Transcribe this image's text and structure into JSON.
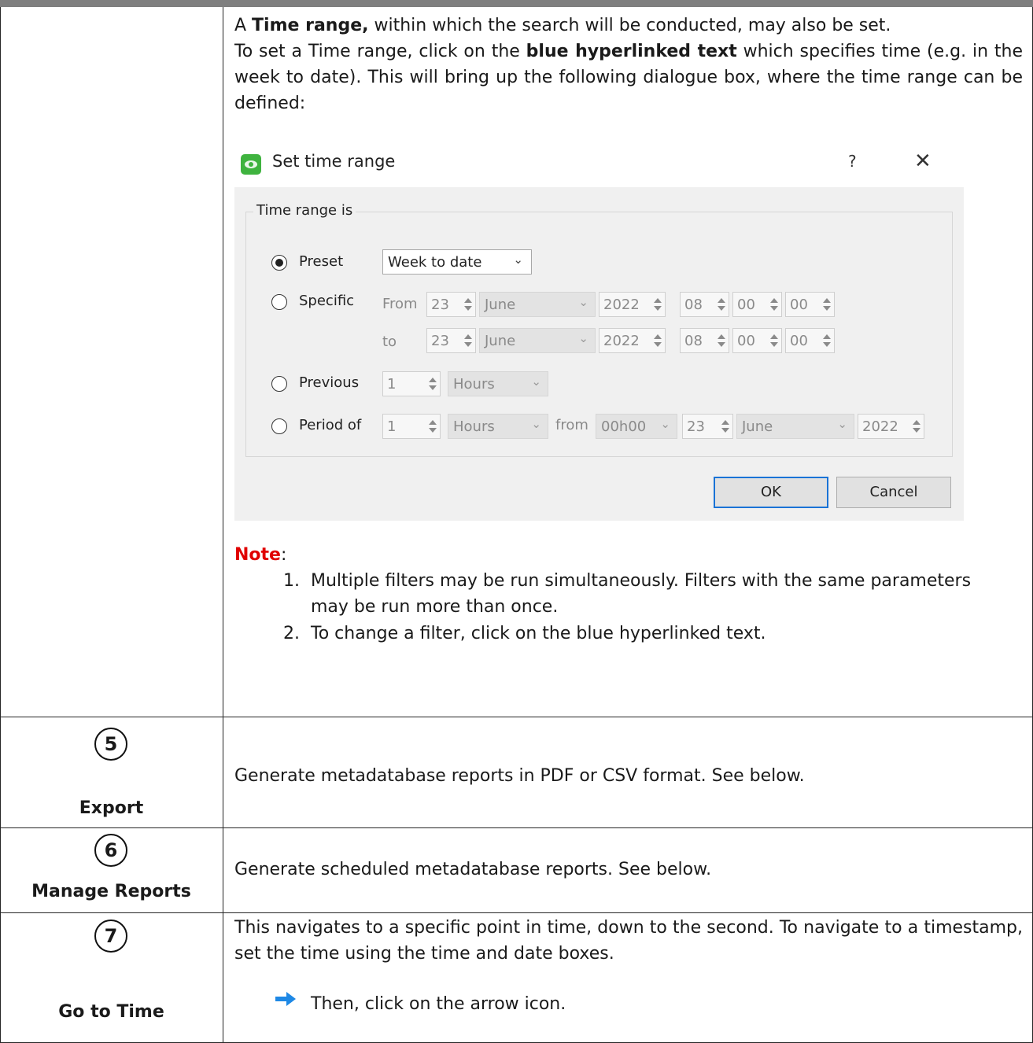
{
  "intro": {
    "line1_pre": "A ",
    "line1_bold": "Time range,",
    "line1_post": " within which the search will be conducted, may also be set.",
    "line2_pre": "To set a Time range, click on the ",
    "line2_bold": "blue hyperlinked text",
    "line2_post": " which specifies time (e.g. in the week to date). This will bring up the following dialogue box, where the time range can be defined:"
  },
  "dialog": {
    "title": "Set time range",
    "help": "?",
    "close": "✕",
    "group_label": "Time range is",
    "preset": {
      "label": "Preset",
      "value": "Week to date",
      "checked": true
    },
    "specific": {
      "label": "Specific",
      "from_label": "From",
      "to_label": "to",
      "from": {
        "day": "23",
        "month": "June",
        "year": "2022",
        "hour": "08",
        "minute": "00",
        "second": "00"
      },
      "to": {
        "day": "23",
        "month": "June",
        "year": "2022",
        "hour": "08",
        "minute": "00",
        "second": "00"
      }
    },
    "previous": {
      "label": "Previous",
      "count": "1",
      "unit": "Hours"
    },
    "period": {
      "label": "Period of",
      "count": "1",
      "unit": "Hours",
      "from_label": "from",
      "time": "00h00",
      "day": "23",
      "month": "June",
      "year": "2022"
    },
    "ok_label": "OK",
    "cancel_label": "Cancel"
  },
  "note": {
    "label": "Note",
    "colon": ":",
    "items": [
      {
        "num": "1.",
        "line1": "Multiple filters may be run simultaneously. Filters with the same parameters",
        "line2": "may be run more than once."
      },
      {
        "num": "2.",
        "line1": "To change a filter, click on the blue hyperlinked text.",
        "line2": ""
      }
    ]
  },
  "rows": [
    {
      "number": "5",
      "title": "Export",
      "description": "Generate metadatabase reports in PDF or CSV format. See below."
    },
    {
      "number": "6",
      "title": "Manage Reports",
      "description": "Generate scheduled metadatabase reports. See below."
    },
    {
      "number": "7",
      "title": "Go to Time",
      "description": "This navigates to a specific point in time, down to the second. To navigate to a timestamp, set the time using the time and date boxes.",
      "step": "Then, click on the arrow icon."
    }
  ],
  "colors": {
    "note_red": "#e00000",
    "arrow_blue": "#1e88e5",
    "dialog_bg": "#f0f0f0"
  }
}
